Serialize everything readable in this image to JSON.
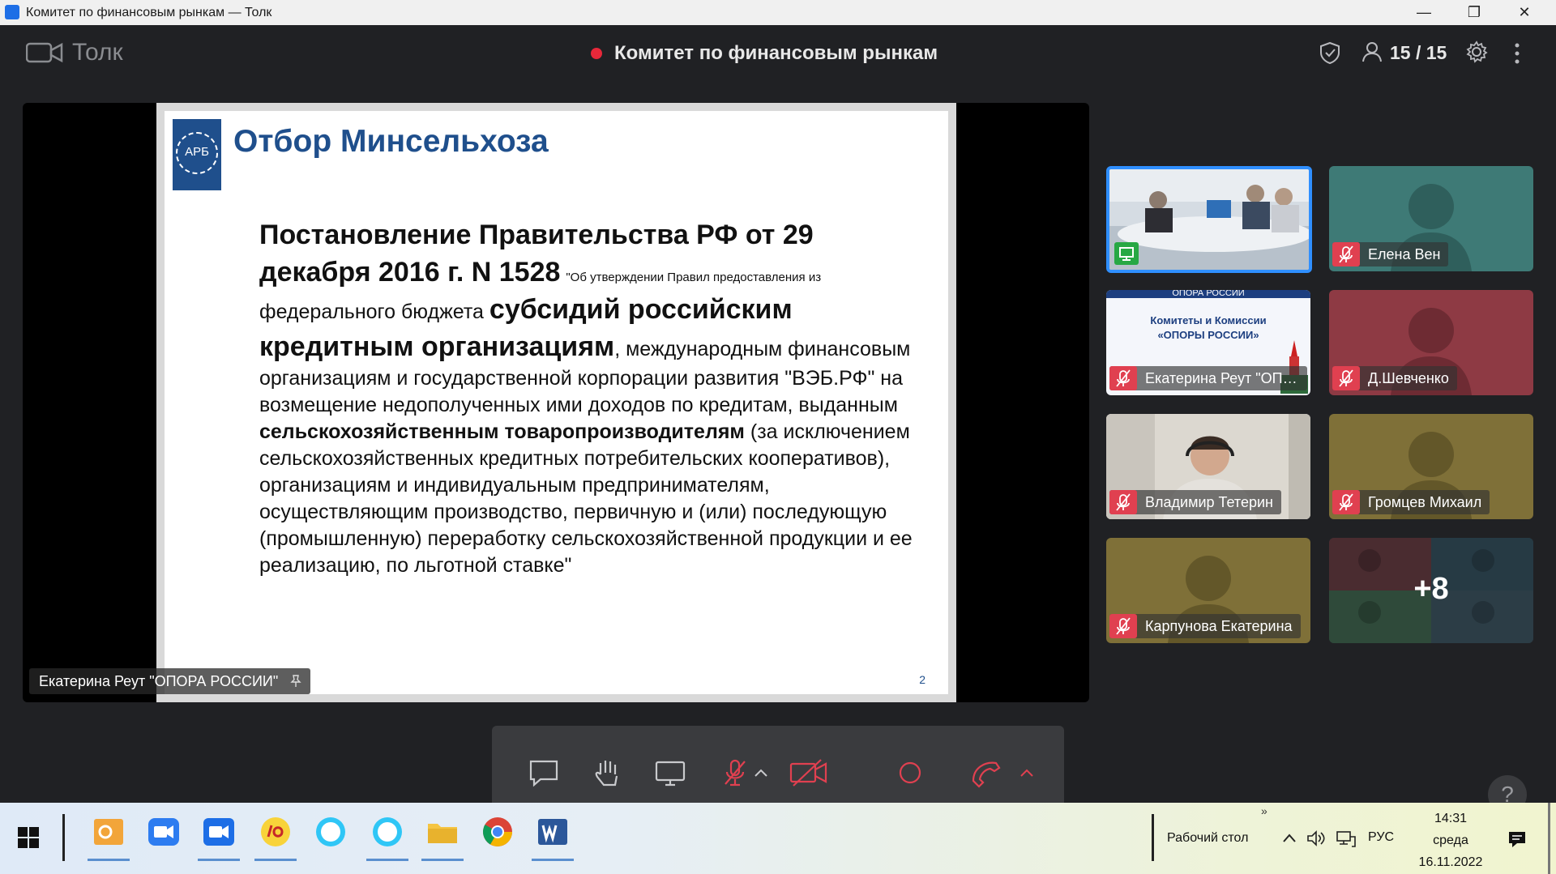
{
  "window": {
    "title": "Комитет по финансовым рынкам — Толк",
    "minimize": "—",
    "restore": "❐",
    "close": "✕"
  },
  "header": {
    "app_name": "Толк",
    "meeting_title": "Комитет по финансовым рынкам",
    "participants_count": "15 / 15"
  },
  "slide": {
    "logo_abbr": "АРБ",
    "title": "Отбор Минсельхоза",
    "heading_big": "Постановление Правительства РФ от 29 декабря 2016 г. N 1528",
    "quote_small": "\"Об утверждении Правил предоставления из",
    "text_1": "федерального бюджета",
    "text_big_2": "субсидий российским кредитным организациям",
    "text_3": ", международным финансовым организациям и государственной корпорации развития \"ВЭБ.РФ\" на возмещение недополученных ими доходов по кредитам, выданным",
    "text_bold_4": "сельскохозяйственным товаропроизводителям",
    "text_5": "(за исключением сельскохозяйственных кредитных потребительских кооперативов), организациям и индивидуальным предпринимателям, осуществляющим производство, первичную и (или) последующую (промышленную) переработку сельскохозяйственной продукции и ее реализацию, по льготной ставке\"",
    "page_number": "2"
  },
  "stage_label": "Екатерина Реут \"ОПОРА РОССИИ\"",
  "tiles": [
    {
      "name": "",
      "bg": "#c9d2db",
      "kind": "video-room",
      "badge": "screen"
    },
    {
      "name": "Елена Вен",
      "bg": "#3e7a76",
      "kind": "avatar",
      "badge": "mic-off"
    },
    {
      "name": "Екатерина Реут \"ОПОРА РОССИИ\"",
      "bg": "#f4f6fb",
      "kind": "banner",
      "badge": "mic-off",
      "banner_top": "ОПОРА РОССИИ",
      "banner_line1": "Комитеты и Комиссии",
      "banner_line2": "«ОПОРЫ РОССИИ»"
    },
    {
      "name": "Д.Шевченко",
      "bg": "#8e3a44",
      "kind": "avatar",
      "badge": "mic-off"
    },
    {
      "name": "Владимир Тетерин",
      "bg": "#d8d4cc",
      "kind": "video-person",
      "badge": "mic-off"
    },
    {
      "name": "Громцев Михаил",
      "bg": "#7f7038",
      "kind": "avatar",
      "badge": "mic-off"
    },
    {
      "name": "Карпунова Екатерина",
      "bg": "#7f7038",
      "kind": "avatar",
      "badge": "mic-off"
    },
    {
      "name": "",
      "bg": "#2d3c44",
      "kind": "more",
      "more_label": "+8"
    }
  ],
  "toolbar": {
    "chat": "chat-icon",
    "raise_hand": "hand-icon",
    "screen_share": "screen-icon",
    "mic": "mic-off-icon",
    "camera": "camera-off-icon",
    "record": "record-icon",
    "hangup": "phone-icon"
  },
  "help_label": "?",
  "taskbar": {
    "desktop_label": "Рабочий стол",
    "language": "РУС",
    "time": "14:31",
    "weekday": "среда",
    "date": "16.11.2022",
    "overflow": "»"
  },
  "colors": {
    "accent_red": "#e04050",
    "share_green": "#27a844",
    "slide_blue": "#1f4f8c"
  }
}
